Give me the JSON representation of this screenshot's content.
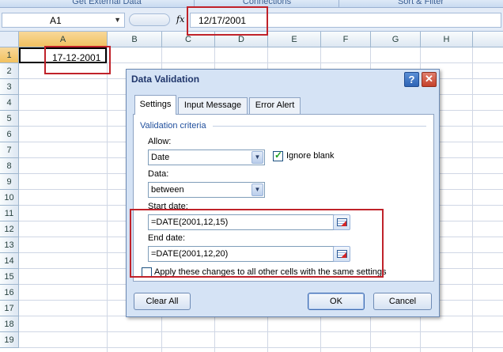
{
  "ribbon": {
    "groups": [
      "Get External Data",
      "Connections",
      "Sort & Filter"
    ]
  },
  "formula_bar": {
    "name_box": "A1",
    "fx_label": "fx",
    "value": "12/17/2001"
  },
  "sheet": {
    "columns": [
      "A",
      "B",
      "C",
      "D",
      "E",
      "F",
      "G",
      "H"
    ],
    "rows": [
      "1",
      "2",
      "3",
      "4",
      "5",
      "6",
      "7",
      "8",
      "9",
      "10",
      "11",
      "12",
      "13",
      "14",
      "15",
      "16",
      "17",
      "18",
      "19"
    ],
    "cell_a1": "17-12-2001"
  },
  "dialog": {
    "title": "Data Validation",
    "help_label": "?",
    "close_label": "✕",
    "tabs": [
      "Settings",
      "Input Message",
      "Error Alert"
    ],
    "active_tab": "Settings",
    "section_label": "Validation criteria",
    "allow_label": "Allow:",
    "allow_value": "Date",
    "ignore_blank_label": "Ignore blank",
    "ignore_blank_checked": true,
    "data_label": "Data:",
    "data_value": "between",
    "start_date_label": "Start date:",
    "start_date_value": "=DATE(2001,12,15)",
    "end_date_label": "End date:",
    "end_date_value": "=DATE(2001,12,20)",
    "apply_all_label": "Apply these changes to all other cells with the same settings",
    "apply_all_checked": false,
    "clear_all_label": "Clear All",
    "ok_label": "OK",
    "cancel_label": "Cancel"
  },
  "colors": {
    "highlight_red": "#c0222a",
    "dialog_bg": "#d5e3f5",
    "header_selected": "#f1c15f"
  },
  "icons": {
    "dropdown": "chevron-down-icon",
    "collapse_dialog": "collapse-dialog-icon",
    "checkbox_check": "check-icon",
    "help": "help-icon",
    "close": "close-icon",
    "function": "fx-icon"
  }
}
